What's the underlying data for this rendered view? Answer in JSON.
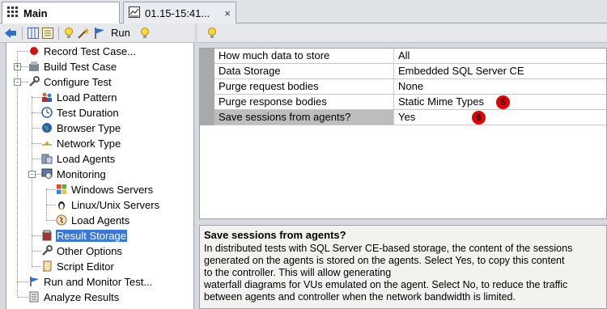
{
  "tabs": [
    {
      "label": "Main",
      "icon": "grid-icon",
      "active": true
    },
    {
      "label": "01.15-15:41...",
      "icon": "report-icon",
      "active": false,
      "close": "×"
    }
  ],
  "left_toolbar": {
    "run_label": "Run",
    "icons": [
      "back-arrow-icon",
      "columns-icon",
      "list-icon",
      "bulb-icon",
      "wand-icon",
      "flag-icon",
      "bulb-icon"
    ]
  },
  "tree": [
    {
      "label": "Record Test Case...",
      "icon": "record-icon"
    },
    {
      "label": "Build Test Case",
      "icon": "box-icon",
      "toggle": "+"
    },
    {
      "label": "Configure Test",
      "icon": "wrench-icon",
      "toggle": "-"
    },
    {
      "label": "Load Pattern",
      "icon": "users-icon"
    },
    {
      "label": "Test Duration",
      "icon": "clock-icon"
    },
    {
      "label": "Browser Type",
      "icon": "globe-icon"
    },
    {
      "label": "Network Type",
      "icon": "network-icon"
    },
    {
      "label": "Load Agents",
      "icon": "agents-icon"
    },
    {
      "label": "Monitoring",
      "icon": "monitor-icon",
      "toggle": "-"
    },
    {
      "label": "Windows Servers",
      "icon": "windows-icon"
    },
    {
      "label": "Linux/Unix Servers",
      "icon": "linux-icon"
    },
    {
      "label": "Load Agents",
      "icon": "agent-gauge-icon"
    },
    {
      "label": "Result Storage",
      "icon": "storage-icon",
      "selected": true
    },
    {
      "label": "Other Options",
      "icon": "wrench-icon"
    },
    {
      "label": "Script Editor",
      "icon": "script-icon"
    },
    {
      "label": "Run and Monitor Test...",
      "icon": "flag-icon"
    },
    {
      "label": "Analyze Results",
      "icon": "results-icon"
    }
  ],
  "properties": [
    {
      "name": "How much data to store",
      "value": "All"
    },
    {
      "name": "Data Storage",
      "value": "Embedded SQL Server CE"
    },
    {
      "name": "Purge request bodies",
      "value": "None"
    },
    {
      "name": "Purge response bodies",
      "value": "Static Mime Types",
      "badge": "5"
    },
    {
      "name": "Save sessions from agents?",
      "value": "Yes",
      "badge": "6",
      "selected": true
    }
  ],
  "description": {
    "title": "Save sessions from agents?",
    "lines": [
      "In distributed tests with SQL Server CE-based storage, the content of the sessions",
      "generated on the agents is stored on the agents. Select Yes, to copy this content",
      "to the controller. This will allow generating",
      "waterfall diagrams for VUs emulated on the agent. Select No, to reduce the traffic",
      "between agents and controller when the network bandwidth is limited."
    ]
  },
  "colors": {
    "selection": "#3a77d6",
    "badge": "#e00000",
    "gutter": "#a9a9a9"
  }
}
